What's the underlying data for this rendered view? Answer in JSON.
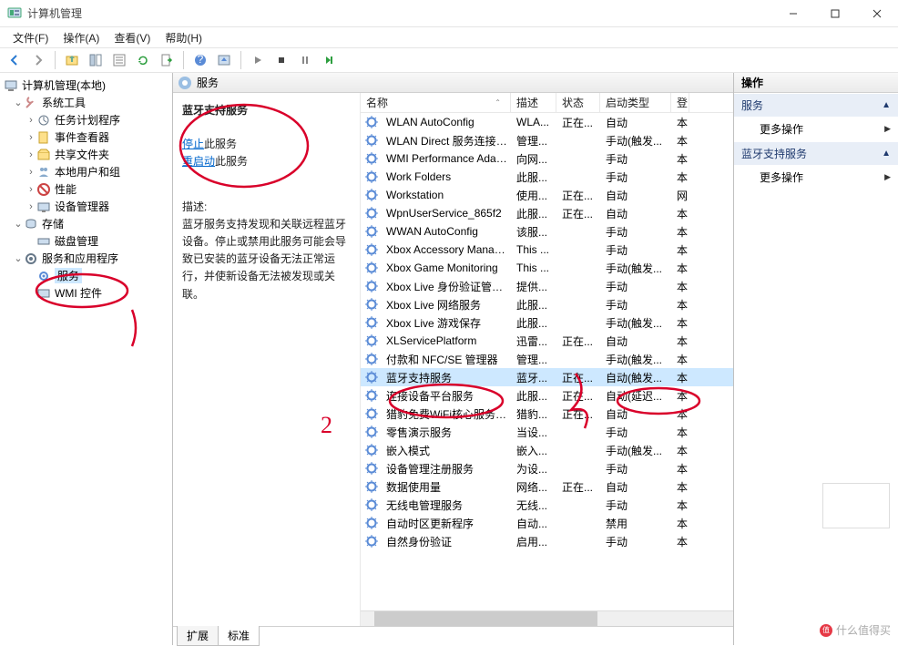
{
  "window": {
    "title": "计算机管理"
  },
  "menu": {
    "file": "文件(F)",
    "action": "操作(A)",
    "view": "查看(V)",
    "help": "帮助(H)"
  },
  "tree": {
    "root": "计算机管理(本地)",
    "sys": "系统工具",
    "sys_items": [
      "任务计划程序",
      "事件查看器",
      "共享文件夹",
      "本地用户和组",
      "性能",
      "设备管理器"
    ],
    "storage": "存储",
    "storage_items": [
      "磁盘管理"
    ],
    "svcapp": "服务和应用程序",
    "svcapp_items": [
      "服务",
      "WMI 控件"
    ]
  },
  "services_header": "服务",
  "desc": {
    "title": "蓝牙支持服务",
    "stop_label": "停止",
    "stop_suffix": "此服务",
    "restart_label": "重启动",
    "restart_suffix": "此服务",
    "heading": "描述:",
    "body": "蓝牙服务支持发现和关联远程蓝牙设备。停止或禁用此服务可能会导致已安装的蓝牙设备无法正常运行，并使新设备无法被发现或关联。"
  },
  "cols": {
    "name": "名称",
    "desc": "描述",
    "status": "状态",
    "startup": "启动类型",
    "logon": "登"
  },
  "rows": [
    {
      "name": "WLAN AutoConfig",
      "desc": "WLA...",
      "status": "正在...",
      "startup": "自动",
      "logon": "本"
    },
    {
      "name": "WLAN Direct 服务连接管...",
      "desc": "管理...",
      "status": "",
      "startup": "手动(触发...",
      "logon": "本"
    },
    {
      "name": "WMI Performance Adapt...",
      "desc": "向网...",
      "status": "",
      "startup": "手动",
      "logon": "本"
    },
    {
      "name": "Work Folders",
      "desc": "此服...",
      "status": "",
      "startup": "手动",
      "logon": "本"
    },
    {
      "name": "Workstation",
      "desc": "使用...",
      "status": "正在...",
      "startup": "自动",
      "logon": "网"
    },
    {
      "name": "WpnUserService_865f2",
      "desc": "此服...",
      "status": "正在...",
      "startup": "自动",
      "logon": "本"
    },
    {
      "name": "WWAN AutoConfig",
      "desc": "该服...",
      "status": "",
      "startup": "手动",
      "logon": "本"
    },
    {
      "name": "Xbox Accessory Manage...",
      "desc": "This ...",
      "status": "",
      "startup": "手动",
      "logon": "本"
    },
    {
      "name": "Xbox Game Monitoring",
      "desc": "This ...",
      "status": "",
      "startup": "手动(触发...",
      "logon": "本"
    },
    {
      "name": "Xbox Live 身份验证管理器",
      "desc": "提供...",
      "status": "",
      "startup": "手动",
      "logon": "本"
    },
    {
      "name": "Xbox Live 网络服务",
      "desc": "此服...",
      "status": "",
      "startup": "手动",
      "logon": "本"
    },
    {
      "name": "Xbox Live 游戏保存",
      "desc": "此服...",
      "status": "",
      "startup": "手动(触发...",
      "logon": "本"
    },
    {
      "name": "XLServicePlatform",
      "desc": "迅雷...",
      "status": "正在...",
      "startup": "自动",
      "logon": "本"
    },
    {
      "name": "付款和 NFC/SE 管理器",
      "desc": "管理...",
      "status": "",
      "startup": "手动(触发...",
      "logon": "本"
    },
    {
      "name": "蓝牙支持服务",
      "desc": "蓝牙...",
      "status": "正在...",
      "startup": "自动(触发...",
      "logon": "本",
      "sel": true
    },
    {
      "name": "连接设备平台服务",
      "desc": "此服...",
      "status": "正在...",
      "startup": "自动(延迟...",
      "logon": "本"
    },
    {
      "name": "猎豹免费WiFi核心服务程序",
      "desc": "猎豹...",
      "status": "正在...",
      "startup": "自动",
      "logon": "本"
    },
    {
      "name": "零售演示服务",
      "desc": "当设...",
      "status": "",
      "startup": "手动",
      "logon": "本"
    },
    {
      "name": "嵌入模式",
      "desc": "嵌入...",
      "status": "",
      "startup": "手动(触发...",
      "logon": "本"
    },
    {
      "name": "设备管理注册服务",
      "desc": "为设...",
      "status": "",
      "startup": "手动",
      "logon": "本"
    },
    {
      "name": "数据使用量",
      "desc": "网络...",
      "status": "正在...",
      "startup": "自动",
      "logon": "本"
    },
    {
      "name": "无线电管理服务",
      "desc": "无线...",
      "status": "",
      "startup": "手动",
      "logon": "本"
    },
    {
      "name": "自动时区更新程序",
      "desc": "自动...",
      "status": "",
      "startup": "禁用",
      "logon": "本"
    },
    {
      "name": "自然身份验证",
      "desc": "启用...",
      "status": "",
      "startup": "手动",
      "logon": "本"
    }
  ],
  "tabs": {
    "ext": "扩展",
    "std": "标准"
  },
  "actions": {
    "title": "操作",
    "group1": "服务",
    "more": "更多操作",
    "group2": "蓝牙支持服务"
  },
  "watermark": "什么值得买"
}
